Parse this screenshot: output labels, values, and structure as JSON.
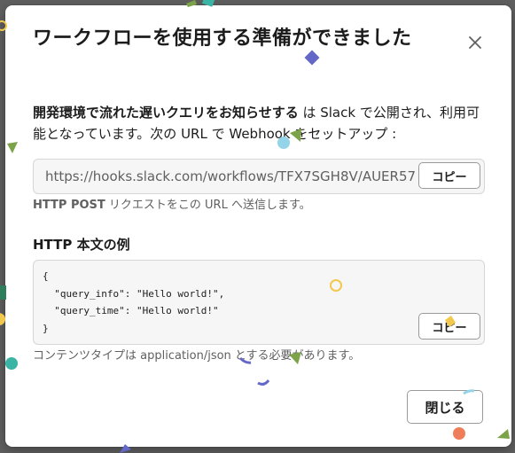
{
  "dialog": {
    "title": "ワークフローを使用する準備ができました",
    "close_icon": "close-icon",
    "description": {
      "workflow_name": "開発環境で流れた遅いクエリをお知らせする",
      "text": " は Slack で公開され、利用可能となっています。次の URL で Webhook をセットアップ :"
    },
    "webhook": {
      "url": "https://hooks.slack.com/workflows/TFX7SGH8V/AUER57",
      "copy_label": "コピー",
      "hint_method": "HTTP POST",
      "hint_text": " リクエストをこの URL へ送信します。"
    },
    "body_example": {
      "heading": "HTTP 本文の例",
      "code": "{\n  \"query_info\": \"Hello world!\",\n  \"query_time\": \"Hello world!\"\n}",
      "copy_label": "コピー",
      "hint": "コンテンツタイプは application/json とする必要があります。"
    },
    "close_button_label": "閉じる"
  },
  "colors": {
    "overlay": "#5f5f5f",
    "text": "#1d1c1d",
    "muted_text": "#616061",
    "code_bg": "#f6f6f6"
  }
}
